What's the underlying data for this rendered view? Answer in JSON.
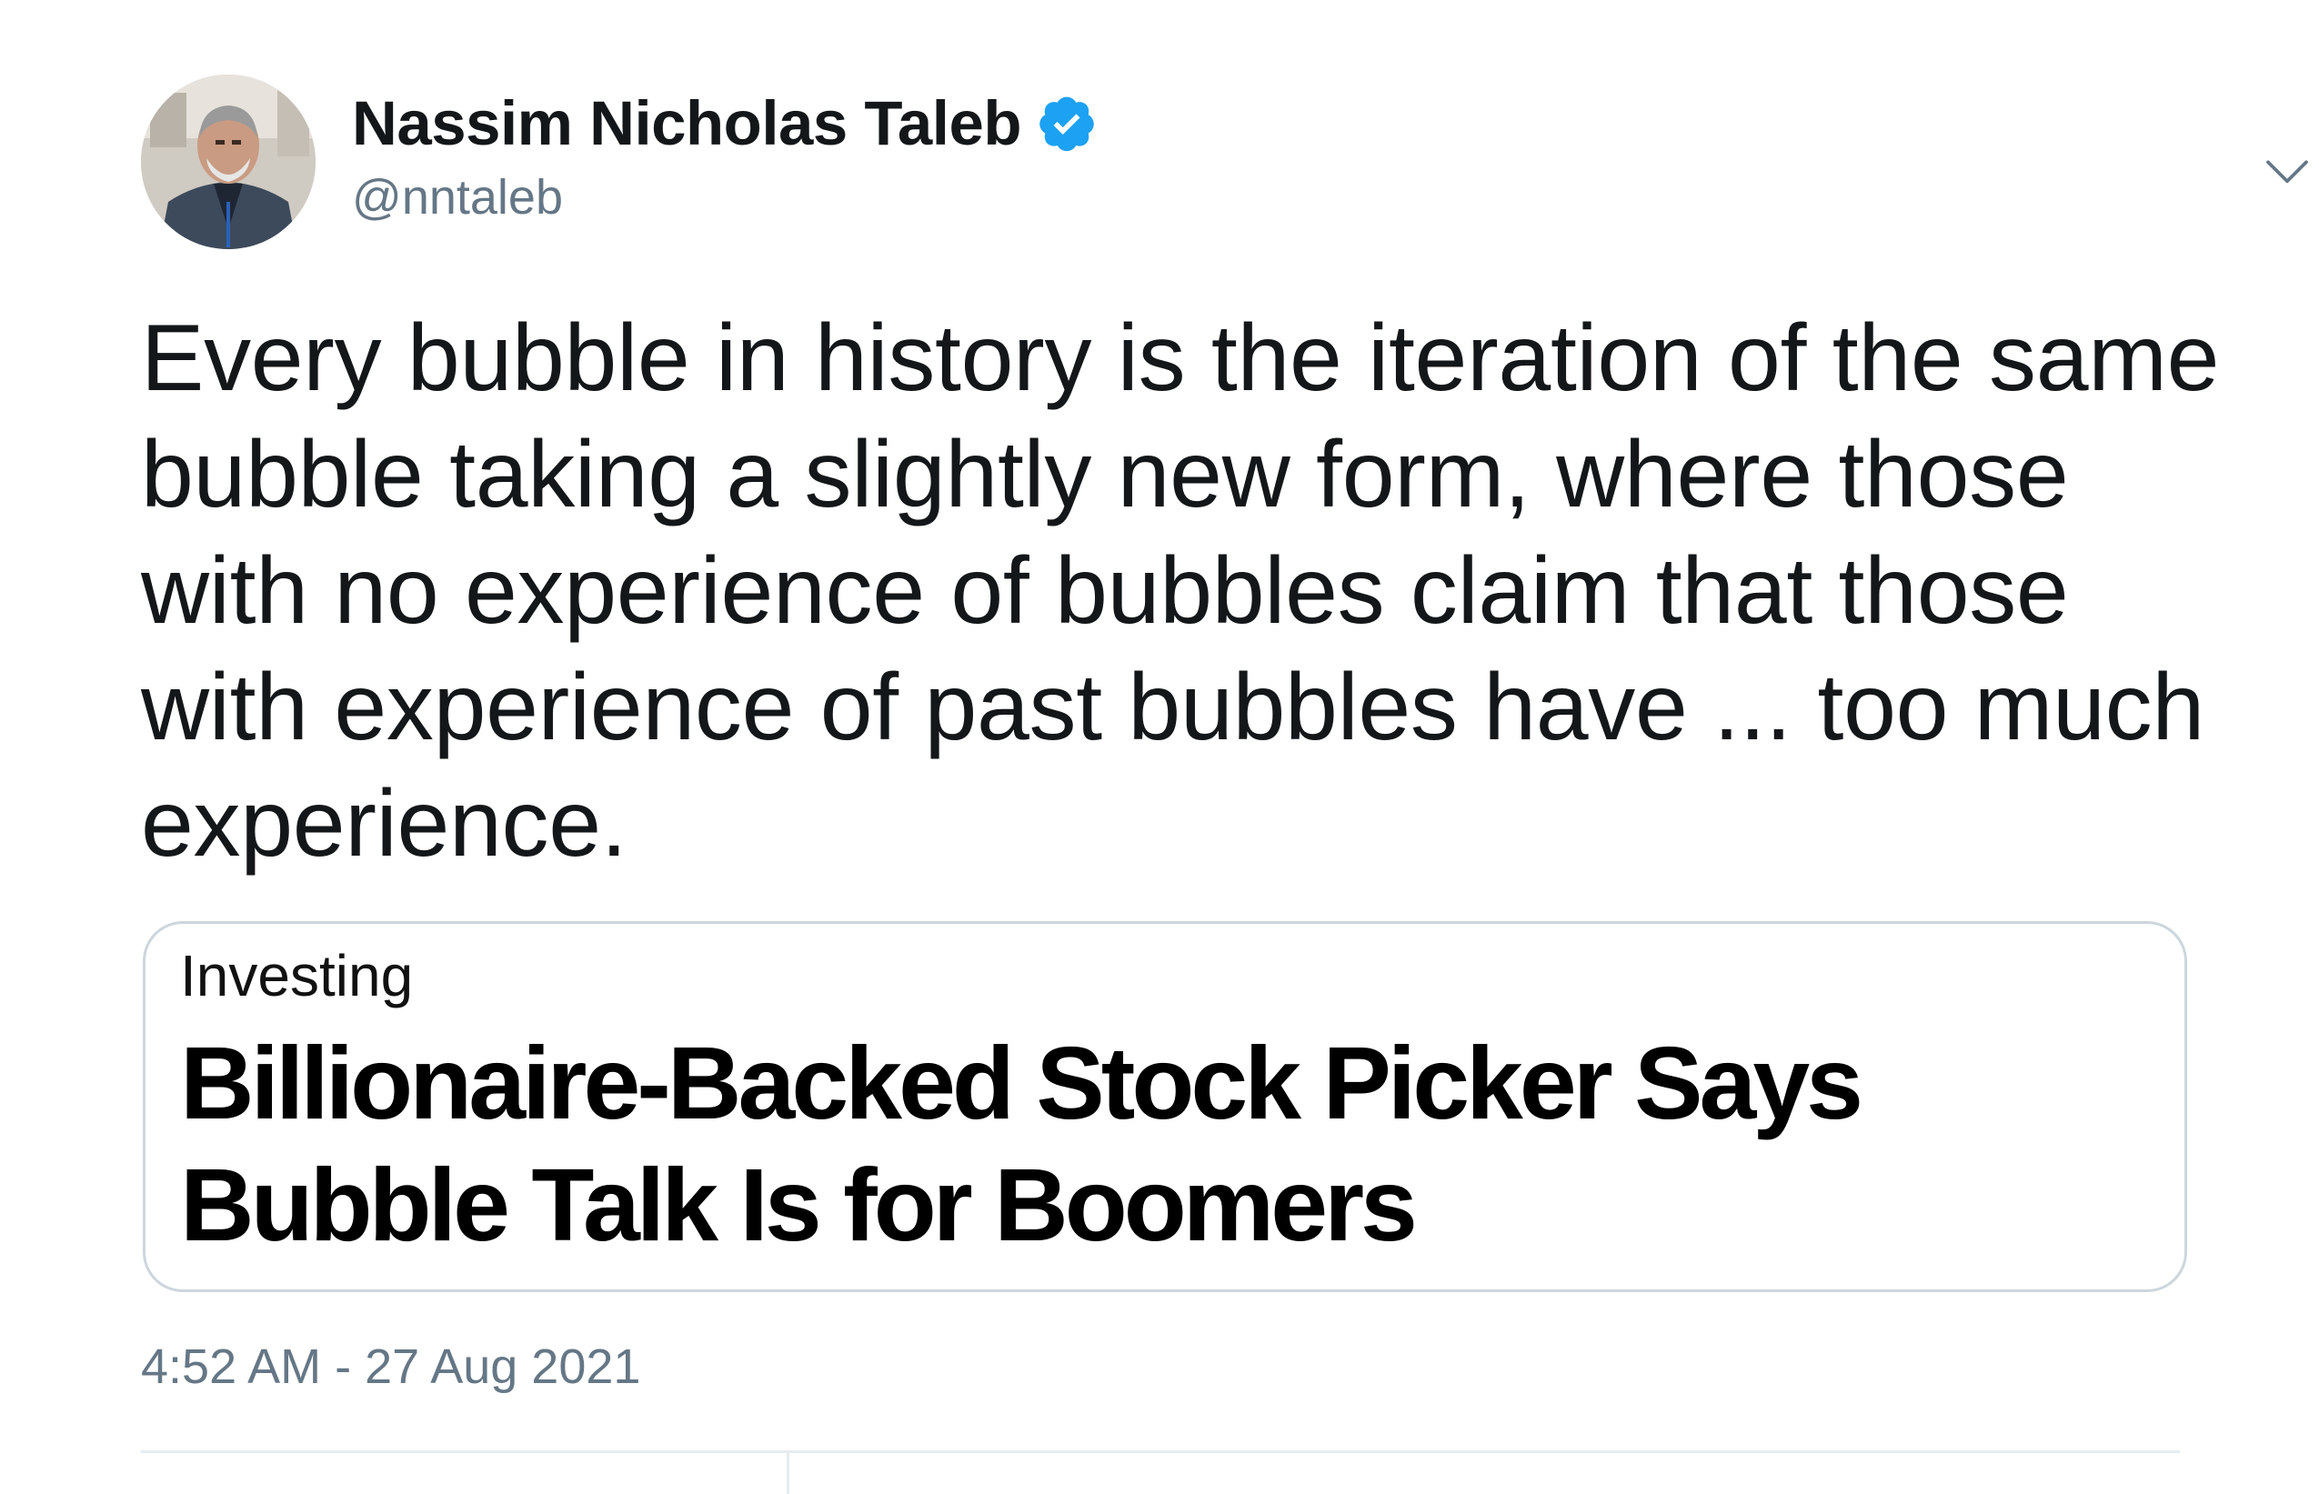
{
  "user": {
    "display_name": "Nassim Nicholas Taleb",
    "handle": "@nntaleb",
    "verified": true,
    "avatar_icon": "profile-photo"
  },
  "tweet": {
    "text": "Every bubble in history is the iteration of the same bubble taking a slightly new form, where those with no experience of bubbles claim that those with experience of past bubbles have ... too much experience.",
    "timestamp": "4:52 AM - 27 Aug 2021"
  },
  "card": {
    "section": "Investing",
    "headline": "Billionaire-Backed Stock Picker Says Bubble Talk Is for Boomers"
  },
  "icons": {
    "verified": "verified-badge-icon",
    "caret": "chevron-down-icon"
  },
  "colors": {
    "verified_blue": "#1da1f2",
    "secondary_text": "#657786",
    "primary_text": "#14171a",
    "border": "#ccd6dd"
  }
}
